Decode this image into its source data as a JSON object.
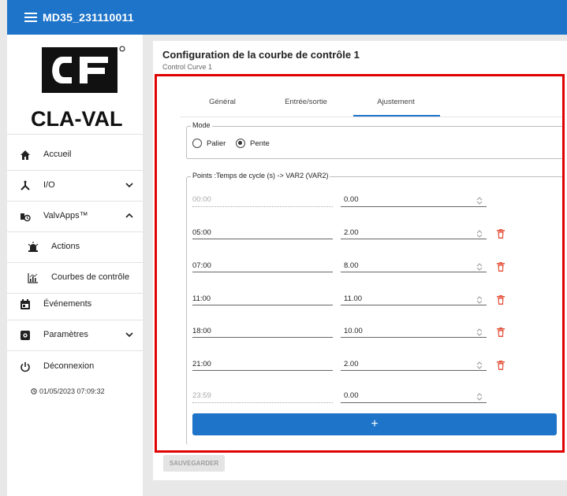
{
  "header": {
    "title": "MD35_231110011"
  },
  "logo": {
    "text": "CLA-VAL"
  },
  "sidebar": {
    "items": [
      {
        "label": "Accueil",
        "icon": "home-icon"
      },
      {
        "label": "I/O",
        "icon": "io-icon"
      },
      {
        "label": "ValvApps™",
        "icon": "valvapps-icon"
      },
      {
        "label": "Actions",
        "icon": "alarm-icon"
      },
      {
        "label": "Courbes de contrôle",
        "icon": "chart-icon"
      },
      {
        "label": "Événements",
        "icon": "calendar-icon"
      },
      {
        "label": "Paramètres",
        "icon": "settings-icon"
      },
      {
        "label": "Déconnexion",
        "icon": "power-icon"
      }
    ],
    "datetime": "01/05/2023 07:09:32"
  },
  "page": {
    "title": "Configuration de la courbe de contrôle 1",
    "subtitle": "Control Curve 1"
  },
  "tabs": [
    {
      "label": "Général"
    },
    {
      "label": "Entrée/sortie"
    },
    {
      "label": "Ajustement"
    }
  ],
  "active_tab": "Ajustement",
  "mode": {
    "legend": "Mode",
    "options": [
      "Palier",
      "Pente"
    ],
    "selected": "Pente"
  },
  "points": {
    "legend": "Points :Temps de cycle (s) -> VAR2 (VAR2)",
    "rows": [
      {
        "time": "00:00",
        "value": "0.00"
      },
      {
        "time": "05:00",
        "value": "2.00"
      },
      {
        "time": "07:00",
        "value": "8.00"
      },
      {
        "time": "11:00",
        "value": "11.00"
      },
      {
        "time": "18:00",
        "value": "10.00"
      },
      {
        "time": "21:00",
        "value": "2.00"
      },
      {
        "time": "23:59",
        "value": "0.00"
      }
    ]
  },
  "buttons": {
    "add": "+",
    "save": "SAUVEGARDER"
  },
  "colors": {
    "primary": "#1e74c9",
    "delete": "#e5533d",
    "highlight": "#e00000"
  }
}
